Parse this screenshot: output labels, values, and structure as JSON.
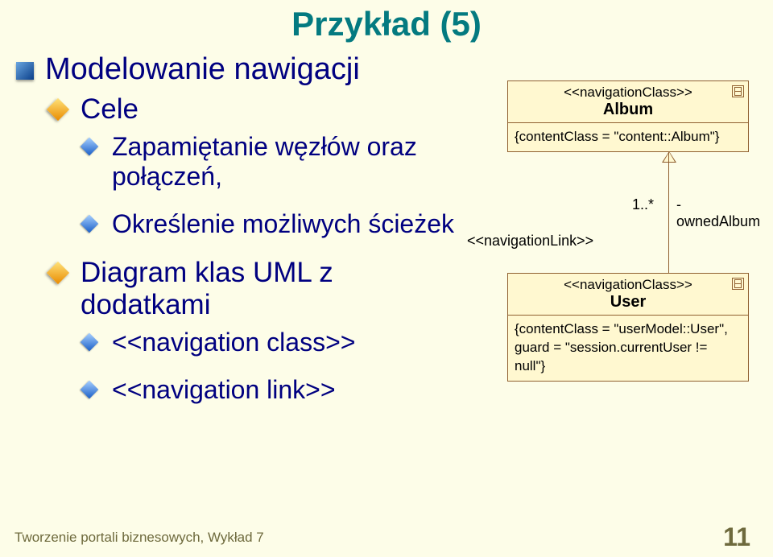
{
  "title": "Przykład (5)",
  "bullets": {
    "l1_1": "Modelowanie nawigacji",
    "l2_1": "Cele",
    "l3_1": "Zapamiętanie węzłów oraz połączeń,",
    "l3_2": "Określenie możliwych ścieżek",
    "l2_2": "Diagram klas UML z dodatkami",
    "l3_3": "<<navigation class>>",
    "l3_4": "<<navigation link>>"
  },
  "diagram": {
    "class1": {
      "stereotype": "<<navigationClass>>",
      "name": "Album",
      "attr": "{contentClass = \"content::Album\"}"
    },
    "assoc": {
      "multiplicity": "1..*",
      "role": "-ownedAlbum",
      "link_stereotype": "<<navigationLink>>"
    },
    "class2": {
      "stereotype": "<<navigationClass>>",
      "name": "User",
      "attr1": "{contentClass = \"userModel::User\",",
      "attr2": "guard = \"session.currentUser != null\"}"
    }
  },
  "footer": {
    "left": "Tworzenie portali biznesowych, Wykład 7",
    "right": "11"
  }
}
